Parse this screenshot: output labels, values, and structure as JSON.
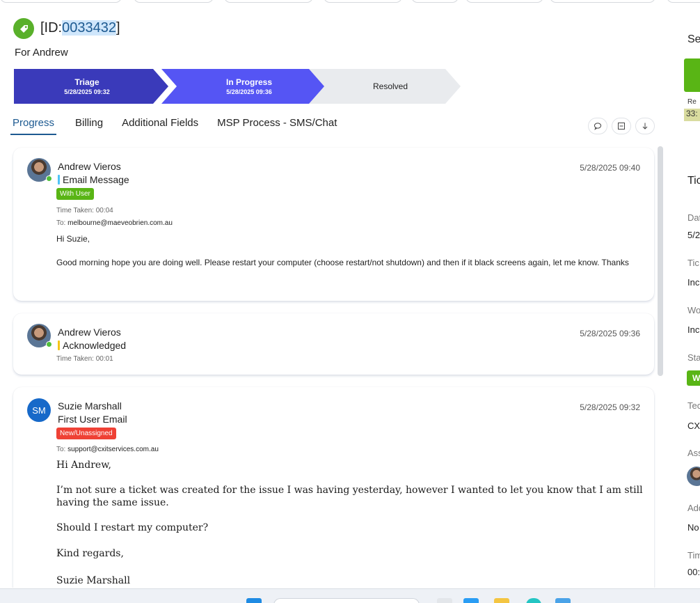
{
  "header": {
    "id_prefix": "[ID:",
    "id_number": "0033432",
    "id_suffix": "]",
    "for_user": "For Andrew"
  },
  "stepper": [
    {
      "title": "Triage",
      "date": "5/28/2025 09:32"
    },
    {
      "title": "In Progress",
      "date": "5/28/2025 09:36"
    },
    {
      "title": "Resolved",
      "date": ""
    }
  ],
  "tabs": [
    "Progress",
    "Billing",
    "Additional Fields",
    "MSP Process - SMS/Chat"
  ],
  "tab_actions": [
    "comment-icon",
    "collapse-icon",
    "download-icon"
  ],
  "feed": [
    {
      "author": "Andrew Vieros",
      "type": "Email Message",
      "type_color": "#4fc3f7",
      "timestamp": "5/28/2025 09:40",
      "badge": "With User",
      "badge_color": "#59b515",
      "time_taken_label": "Time Taken:",
      "time_taken": "00:04",
      "to_label": "To:",
      "to": "melbourne@maeveobrien.com.au",
      "body": [
        "Hi Suzie,",
        "Good morning hope you are doing well. Please restart your computer (choose restart/not shutdown) and then if it black screens again, let me know. Thanks"
      ]
    },
    {
      "author": "Andrew Vieros",
      "type": "Acknowledged",
      "type_color": "#f5c518",
      "timestamp": "5/28/2025 09:36",
      "time_taken_label": "Time Taken:",
      "time_taken": "00:01"
    },
    {
      "author": "Suzie Marshall",
      "initials": "SM",
      "type": "First User Email",
      "timestamp": "5/28/2025 09:32",
      "badge": "New/Unassigned",
      "badge_color": "#ef4135",
      "to_label": "To:",
      "to": "support@cxitservices.com.au",
      "body": [
        "Hi Andrew,",
        "I’m not sure a ticket was created for the issue I was having yesterday, however I wanted to let you know that I am still having the same issue.",
        "Should I restart my computer?",
        "Kind regards,",
        "Suzie Marshall"
      ]
    }
  ],
  "right_panel": {
    "section1_heading": "Se",
    "green_label": "Re",
    "timer": "33:",
    "section2_heading": "Tic",
    "fields": [
      {
        "label": "Dat",
        "value": "5/2"
      },
      {
        "label": "Tic",
        "value": "Inc"
      },
      {
        "label": "Wo",
        "value": "Inc"
      },
      {
        "label": "Sta",
        "value": "W"
      },
      {
        "label": "Tec",
        "value": "CX"
      },
      {
        "label": "Ass",
        "value": ""
      },
      {
        "label": "Add",
        "value": "No"
      },
      {
        "label": "Tim",
        "value": "00:"
      }
    ]
  }
}
